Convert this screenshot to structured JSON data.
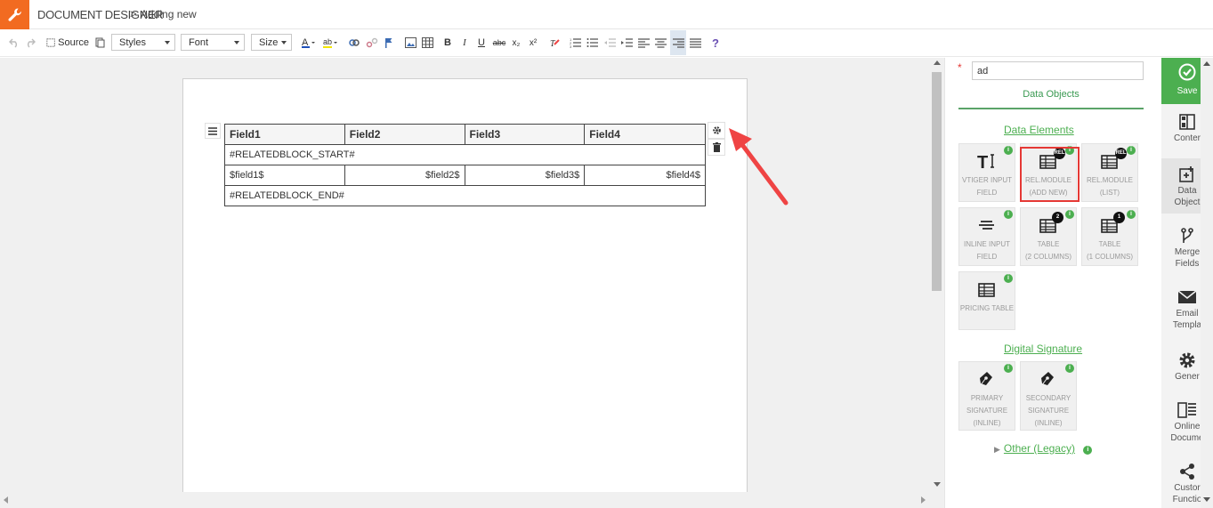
{
  "header": {
    "brand": "DOCUMENT DESIGNER",
    "separator": ">",
    "breadcrumb": "Adding new"
  },
  "toolbar": {
    "source_label": "Source",
    "styles_label": "Styles",
    "font_label": "Font",
    "size_label": "Size",
    "bold": "B",
    "italic": "I",
    "underline": "U",
    "strike": "abc",
    "subscript": "x₂",
    "superscript": "x²",
    "help": "?"
  },
  "document": {
    "headers": [
      "Field1",
      "Field2",
      "Field3",
      "Field4"
    ],
    "block_start": "#RELATEDBLOCK_START#",
    "row_fields": [
      "$field1$",
      "$field2$",
      "$field3$",
      "$field4$"
    ],
    "block_end": "#RELATEDBLOCK_END#"
  },
  "panel": {
    "required_mark": "*",
    "search_value": "ad",
    "tab_label": "Data Objects",
    "data_elements_title": "Data Elements",
    "tiles": [
      {
        "line1": "VTIGER INPUT",
        "line2": "FIELD",
        "icon": "text-cursor-icon"
      },
      {
        "line1": "REL.MODULE",
        "line2": "(ADD NEW)",
        "icon": "table-rel-icon",
        "badge": "REL"
      },
      {
        "line1": "REL.MODULE",
        "line2": "(LIST)",
        "icon": "table-rel-icon",
        "badge": "REL"
      },
      {
        "line1": "INLINE INPUT",
        "line2": "FIELD",
        "icon": "lines-icon"
      },
      {
        "line1": "TABLE",
        "line2": "(2 COLUMNS)",
        "icon": "table-icon",
        "badge": "2"
      },
      {
        "line1": "TABLE",
        "line2": "(1 COLUMNS)",
        "icon": "table-icon",
        "badge": "1"
      },
      {
        "line1": "PRICING TABLE",
        "line2": "",
        "icon": "table-icon"
      }
    ],
    "info_mark": "i",
    "signature_title": "Digital Signature",
    "signatures": [
      {
        "line1": "PRIMARY",
        "line2": "SIGNATURE",
        "line3": "(INLINE)"
      },
      {
        "line1": "SECONDARY",
        "line2": "SIGNATURE",
        "line3": "(INLINE)"
      }
    ],
    "other_label": "Other (Legacy)"
  },
  "rail": {
    "save": "Save",
    "items": [
      {
        "line1": "Conter",
        "line2": ""
      },
      {
        "line1": "Data",
        "line2": "Object"
      },
      {
        "line1": "Merge",
        "line2": "Fields"
      },
      {
        "line1": "Email",
        "line2": "Templa"
      },
      {
        "line1": "Gener",
        "line2": ""
      },
      {
        "line1": "Online",
        "line2": "Docume"
      },
      {
        "line1": "Custor",
        "line2": "Functio"
      }
    ]
  },
  "colors": {
    "brand_orange": "#f26b21",
    "accent_green": "#4caf50",
    "highlight_red": "#e53935"
  }
}
